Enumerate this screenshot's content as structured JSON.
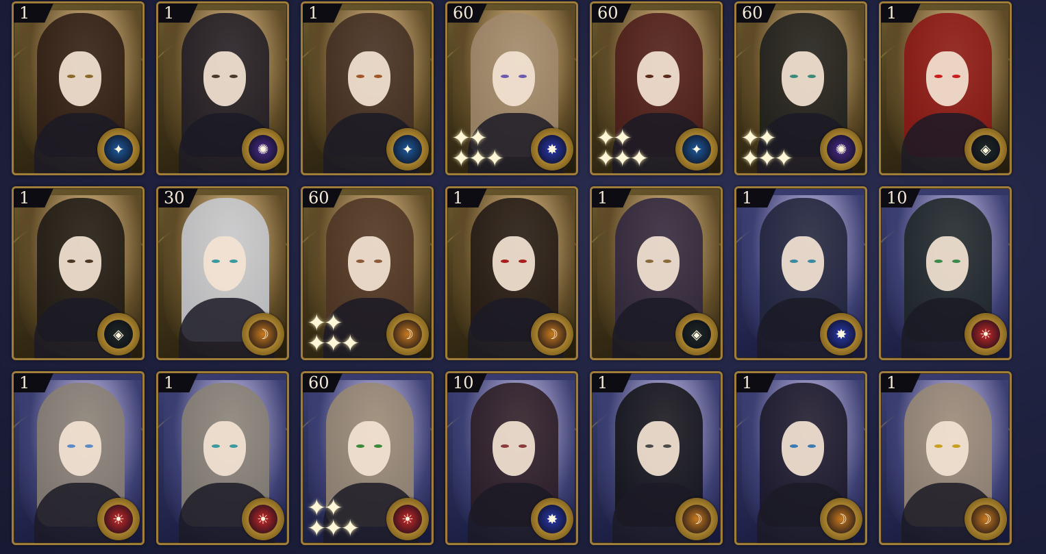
{
  "colors": {
    "frame_gold": "#a07e3a",
    "badge_bg": "#0d0c12",
    "badge_text": "#f4ead6"
  },
  "cards": [
    {
      "count": "1",
      "theme": "gold",
      "hair": "#2a1a14",
      "eye": "#8a6a2a",
      "emblem": "planet-emblem",
      "emblem_color": "#1e5a9c",
      "glyph": "✦",
      "sparkles": false
    },
    {
      "count": "1",
      "theme": "gold",
      "hair": "#1c1a26",
      "eye": "#4a3a2a",
      "emblem": "galaxy-emblem",
      "emblem_color": "#4a2c8c",
      "glyph": "✺",
      "sparkles": false
    },
    {
      "count": "1",
      "theme": "gold",
      "hair": "#3e2c22",
      "eye": "#a0582a",
      "emblem": "planet-emblem",
      "emblem_color": "#1e5a9c",
      "glyph": "✦",
      "sparkles": false
    },
    {
      "count": "60",
      "theme": "gold",
      "hair": "#a08a6e",
      "eye": "#6c5ab0",
      "emblem": "nebula-emblem",
      "emblem_color": "#2a3ab0",
      "glyph": "✸",
      "sparkles": true
    },
    {
      "count": "60",
      "theme": "gold",
      "hair": "#4a1a1a",
      "eye": "#5a2a1a",
      "emblem": "planet-emblem",
      "emblem_color": "#1e5a9c",
      "glyph": "✦",
      "sparkles": true
    },
    {
      "count": "60",
      "theme": "gold",
      "hair": "#1a1c1c",
      "eye": "#3a8a7a",
      "emblem": "galaxy-emblem",
      "emblem_color": "#4a2c8c",
      "glyph": "✺",
      "sparkles": true
    },
    {
      "count": "1",
      "theme": "gold",
      "hair": "#8a1414",
      "eye": "#c81e1e",
      "emblem": "compass-emblem",
      "emblem_color": "#1e2a26",
      "glyph": "◈",
      "sparkles": false
    },
    {
      "count": "1",
      "theme": "gold",
      "hair": "#1a1614",
      "eye": "#4a3622",
      "emblem": "compass-emblem",
      "emblem_color": "#1e2a26",
      "glyph": "◈",
      "sparkles": false
    },
    {
      "count": "30",
      "theme": "gold",
      "hair": "#c8ccd6",
      "eye": "#3a9aa0",
      "emblem": "moon-emblem",
      "emblem_color": "#c87a1e",
      "glyph": "☽",
      "sparkles": false
    },
    {
      "count": "60",
      "theme": "gold",
      "hair": "#4a3224",
      "eye": "#8a5a3a",
      "emblem": "moon-emblem",
      "emblem_color": "#c87a1e",
      "glyph": "☽",
      "sparkles": true
    },
    {
      "count": "1",
      "theme": "gold",
      "hair": "#1e1614",
      "eye": "#a81e1e",
      "emblem": "moon-emblem",
      "emblem_color": "#c87a1e",
      "glyph": "☽",
      "sparkles": false
    },
    {
      "count": "1",
      "theme": "gold",
      "hair": "#2c2440",
      "eye": "#8a6a3a",
      "emblem": "compass-emblem",
      "emblem_color": "#1e2a26",
      "glyph": "◈",
      "sparkles": false
    },
    {
      "count": "1",
      "theme": "blue",
      "hair": "#1e2236",
      "eye": "#3a8aa0",
      "emblem": "nebula-emblem",
      "emblem_color": "#2a3ab0",
      "glyph": "✸",
      "sparkles": false
    },
    {
      "count": "10",
      "theme": "blue",
      "hair": "#1c2422",
      "eye": "#3a8a4a",
      "emblem": "sun-emblem",
      "emblem_color": "#c82a2a",
      "glyph": "☀",
      "sparkles": false
    },
    {
      "count": "1",
      "theme": "blue",
      "hair": "#8a8070",
      "eye": "#5a8ac8",
      "emblem": "sun-emblem",
      "emblem_color": "#c82a2a",
      "glyph": "☀",
      "sparkles": false
    },
    {
      "count": "1",
      "theme": "blue",
      "hair": "#8a8272",
      "eye": "#3a9aa0",
      "emblem": "sun-emblem",
      "emblem_color": "#c82a2a",
      "glyph": "☀",
      "sparkles": false
    },
    {
      "count": "60",
      "theme": "blue",
      "hair": "#9a8a70",
      "eye": "#3a8a3a",
      "emblem": "sun-emblem",
      "emblem_color": "#c82a2a",
      "glyph": "☀",
      "sparkles": true
    },
    {
      "count": "10",
      "theme": "blue",
      "hair": "#2a1a1e",
      "eye": "#8a3a3a",
      "emblem": "nebula-emblem",
      "emblem_color": "#2a3ab0",
      "glyph": "✸",
      "sparkles": false
    },
    {
      "count": "1",
      "theme": "blue",
      "hair": "#121214",
      "eye": "#4a4a4a",
      "emblem": "moon-emblem",
      "emblem_color": "#c87a1e",
      "glyph": "☽",
      "sparkles": false
    },
    {
      "count": "1",
      "theme": "blue",
      "hair": "#1a1624",
      "eye": "#3a7ab0",
      "emblem": "moon-emblem",
      "emblem_color": "#c87a1e",
      "glyph": "☽",
      "sparkles": false
    },
    {
      "count": "1",
      "theme": "blue",
      "hair": "#9a8a72",
      "eye": "#c8a01e",
      "emblem": "moon-emblem",
      "emblem_color": "#c87a1e",
      "glyph": "☽",
      "sparkles": false
    }
  ]
}
